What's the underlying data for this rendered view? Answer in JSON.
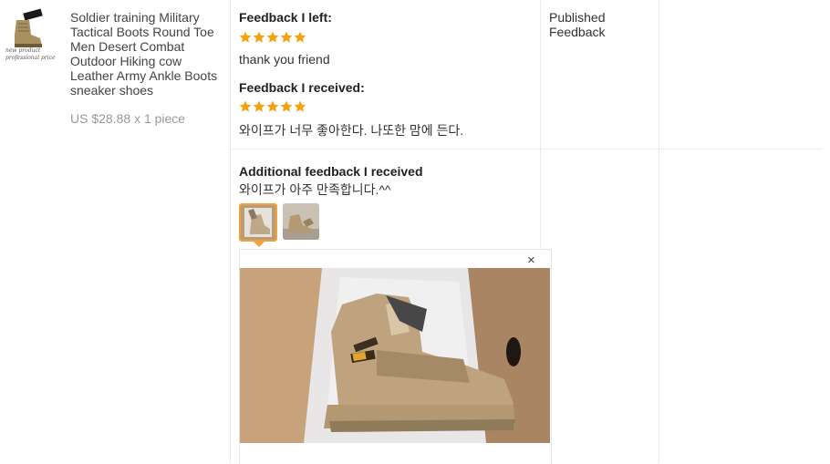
{
  "product": {
    "thumb_caption_line1": "new product",
    "thumb_caption_line2": "professional price",
    "title": "Soldier training Military Tactical Boots Round Toe Men Desert Combat Outdoor Hiking cow Leather Army Ankle Boots sneaker shoes",
    "price": "US $28.88 x 1 piece"
  },
  "feedback_left": {
    "heading": "Feedback I left:",
    "stars": 5,
    "text": "thank you friend"
  },
  "feedback_received": {
    "heading": "Feedback I received:",
    "stars": 5,
    "text": "와이프가 너무 좋아한다. 나또한 맘에 든다."
  },
  "additional": {
    "heading": "Additional feedback I received",
    "text": "와이프가 아주 만족합니다.^^",
    "close_glyph": "×"
  },
  "status": {
    "label": "Published Feedback"
  },
  "colors": {
    "star": "#f5a10c",
    "selected_thumb_border": "#f0a23a"
  },
  "icons": [
    "star-icon",
    "close-icon"
  ]
}
